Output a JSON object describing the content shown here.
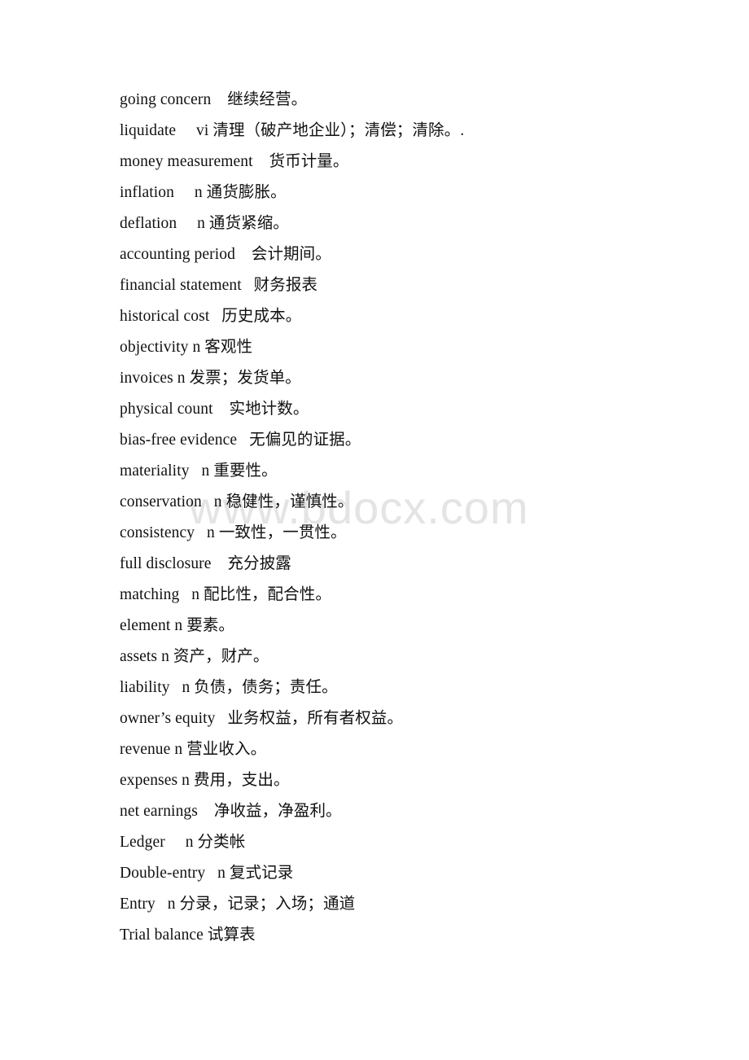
{
  "document": {
    "background_color": "#ffffff",
    "text_color": "#111111"
  },
  "watermark": {
    "text": "www.bdocx.com",
    "color": "#e4e4e4"
  },
  "glossary": {
    "entries": [
      {
        "text": "going concern    继续经营。"
      },
      {
        "text": "liquidate     vi 清理（破产地企业）；清偿；清除。."
      },
      {
        "text": "money measurement    货币计量。"
      },
      {
        "text": "inflation     n 通货膨胀。"
      },
      {
        "text": "deflation     n 通货紧缩。"
      },
      {
        "text": "accounting period    会计期间。"
      },
      {
        "text": "financial statement   财务报表"
      },
      {
        "text": "historical cost   历史成本。"
      },
      {
        "text": "objectivity n 客观性"
      },
      {
        "text": "invoices n 发票；发货单。"
      },
      {
        "text": "physical count    实地计数。"
      },
      {
        "text": "bias-free evidence   无偏见的证据。"
      },
      {
        "text": "materiality   n 重要性。"
      },
      {
        "text": "conservation   n 稳健性，谨慎性。"
      },
      {
        "text": "consistency   n 一致性，一贯性。"
      },
      {
        "text": "full disclosure    充分披露"
      },
      {
        "text": "matching   n 配比性，配合性。"
      },
      {
        "text": "element n 要素。"
      },
      {
        "text": "assets n 资产，财产。"
      },
      {
        "text": "liability   n 负债，债务；责任。"
      },
      {
        "text": "owner’s equity   业务权益，所有者权益。"
      },
      {
        "text": "revenue n 营业收入。"
      },
      {
        "text": "expenses n 费用，支出。"
      },
      {
        "text": "net earnings    净收益，净盈利。"
      },
      {
        "text": "Ledger     n 分类帐"
      },
      {
        "text": "Double-entry   n 复式记录"
      },
      {
        "text": "Entry   n 分录，记录；入场；通道"
      },
      {
        "text": "Trial balance 试算表"
      }
    ]
  }
}
